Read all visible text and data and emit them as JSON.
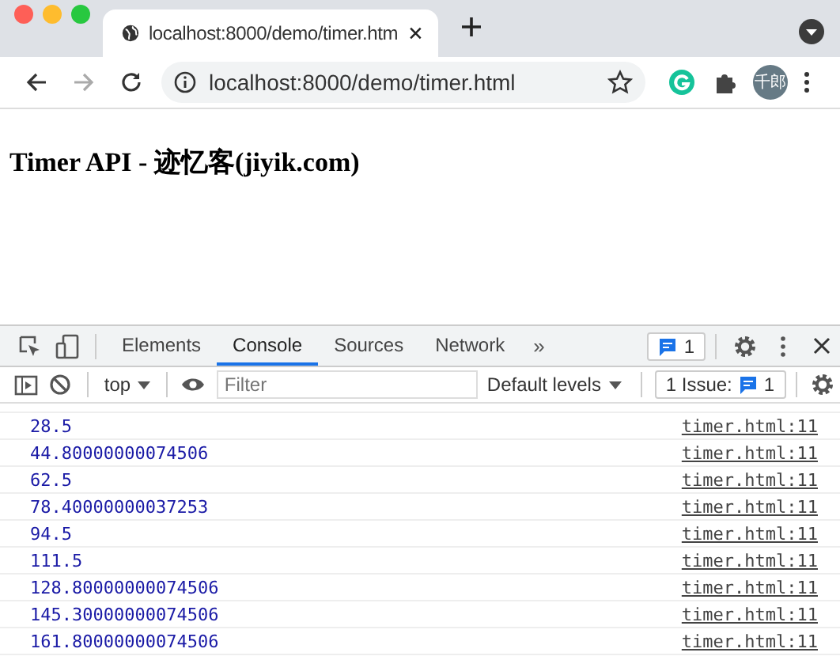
{
  "browser": {
    "tab": {
      "title": "localhost:8000/demo/timer.htm"
    },
    "address": "localhost:8000/demo/timer.html",
    "profile": "千郎"
  },
  "page": {
    "heading": "Timer API - 迹忆客(jiyik.com)"
  },
  "devtools": {
    "tabs": [
      {
        "label": "Elements",
        "selected": false
      },
      {
        "label": "Console",
        "selected": true
      },
      {
        "label": "Sources",
        "selected": false
      },
      {
        "label": "Network",
        "selected": false
      }
    ],
    "more": "»",
    "message_count": "1",
    "context": "top",
    "filter": {
      "placeholder": "Filter"
    },
    "levels": "Default levels",
    "issues": {
      "label": "1 Issue:",
      "count": "1"
    }
  },
  "console": {
    "rows": [
      {
        "value": "28.5",
        "source": "timer.html:11"
      },
      {
        "value": "44.80000000074506",
        "source": "timer.html:11"
      },
      {
        "value": "62.5",
        "source": "timer.html:11"
      },
      {
        "value": "78.40000000037253",
        "source": "timer.html:11"
      },
      {
        "value": "94.5",
        "source": "timer.html:11"
      },
      {
        "value": "111.5",
        "source": "timer.html:11"
      },
      {
        "value": "128.80000000074506",
        "source": "timer.html:11"
      },
      {
        "value": "145.30000000074506",
        "source": "timer.html:11"
      },
      {
        "value": "161.80000000074506",
        "source": "timer.html:11"
      }
    ]
  }
}
